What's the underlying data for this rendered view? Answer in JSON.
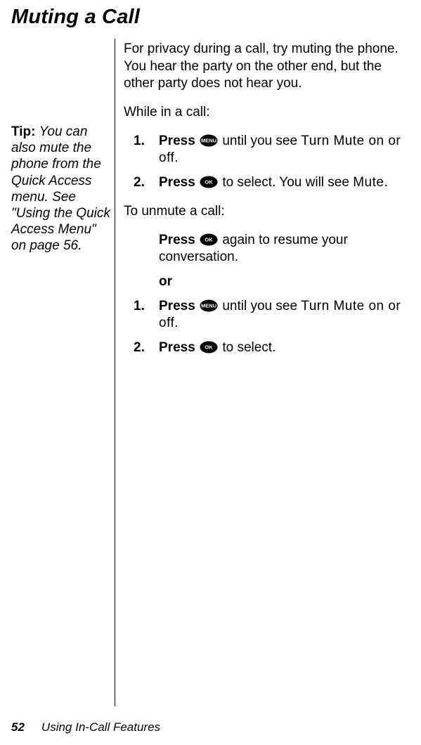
{
  "heading": "Muting a Call",
  "intro": "For privacy during a call, try muting the phone. You hear the party on the other end, but the other party does not hear you.",
  "while_in_call_label": "While in a call:",
  "tip": {
    "label": "Tip: ",
    "text": "You can also mute the phone from the Quick Access menu. See \"Using the Quick Access Menu\" on page 56."
  },
  "steps_mute": [
    {
      "num": "1.",
      "press": "Press ",
      "icon": "menu-icon",
      "after": " until you see ",
      "screen": "Turn Mute on or off",
      "end": "."
    },
    {
      "num": "2.",
      "press": "Press ",
      "icon": "ok-icon",
      "after": " to select. You will see ",
      "screen": "Mute",
      "end": "."
    }
  ],
  "to_unmute_label": "To unmute a call:",
  "unmute_intro": {
    "press": "Press ",
    "icon": "ok-icon",
    "after": " again to resume your conversation."
  },
  "or_label": "or",
  "steps_unmute": [
    {
      "num": "1.",
      "press": "Press ",
      "icon": "menu-icon",
      "after": " until you see ",
      "screen": "Turn Mute on or off",
      "end": "."
    },
    {
      "num": "2.",
      "press": "Press ",
      "icon": "ok-icon",
      "after": " to select.",
      "screen": "",
      "end": ""
    }
  ],
  "footer": {
    "page": "52",
    "chapter": "Using In-Call Features"
  },
  "icons": {
    "menu-icon": "MENU",
    "ok-icon": "OK"
  }
}
